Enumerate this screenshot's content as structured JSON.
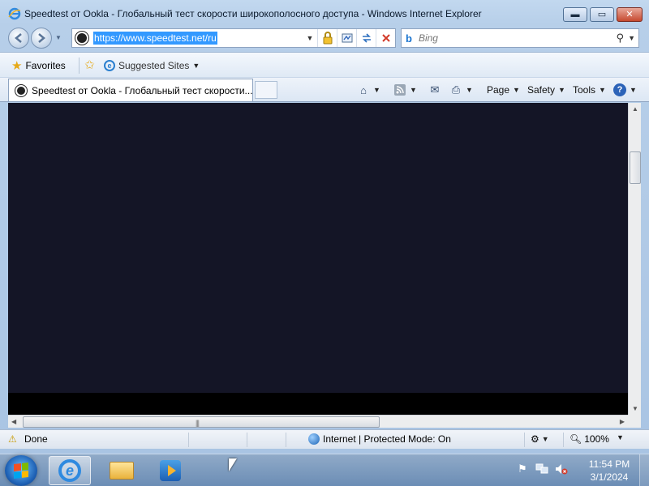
{
  "window": {
    "title": "Speedtest от Ookla - Глобальный тест скорости широкополосного доступа - Windows Internet Explorer",
    "caption_minimize": "▬",
    "caption_maximize": "▭",
    "caption_close": "✕"
  },
  "address_bar": {
    "url": "https://www.speedtest.net/ru",
    "site_icon": "speedtest-icon",
    "tools": [
      "dropdown-arrow-icon",
      "lock-icon",
      "compatibility-icon",
      "refresh-icon",
      "stop-icon"
    ]
  },
  "search": {
    "placeholder": "Bing",
    "provider_icon": "bing-icon"
  },
  "favorites_bar": {
    "favorites_label": "Favorites",
    "suggested_sites_label": "Suggested Sites"
  },
  "tabs": [
    {
      "title": "Speedtest от Ookla - Глобальный тест скорости...",
      "active": true
    }
  ],
  "command_bar": {
    "page_label": "Page",
    "safety_label": "Safety",
    "tools_label": "Tools"
  },
  "content": {
    "background_color": "#141526"
  },
  "status_bar": {
    "status_text": "Done",
    "zone_text": "Internet | Protected Mode: On",
    "zoom_text": "100%"
  },
  "taskbar": {
    "clock_time": "11:54 PM",
    "clock_date": "3/1/2024",
    "pinned": [
      "internet-explorer-icon",
      "windows-explorer-icon",
      "media-player-icon"
    ]
  },
  "colors": {
    "frame": "#b7cfe9",
    "selection": "#3399ff",
    "page_background": "#141526",
    "taskbar": "#6b8db5"
  }
}
